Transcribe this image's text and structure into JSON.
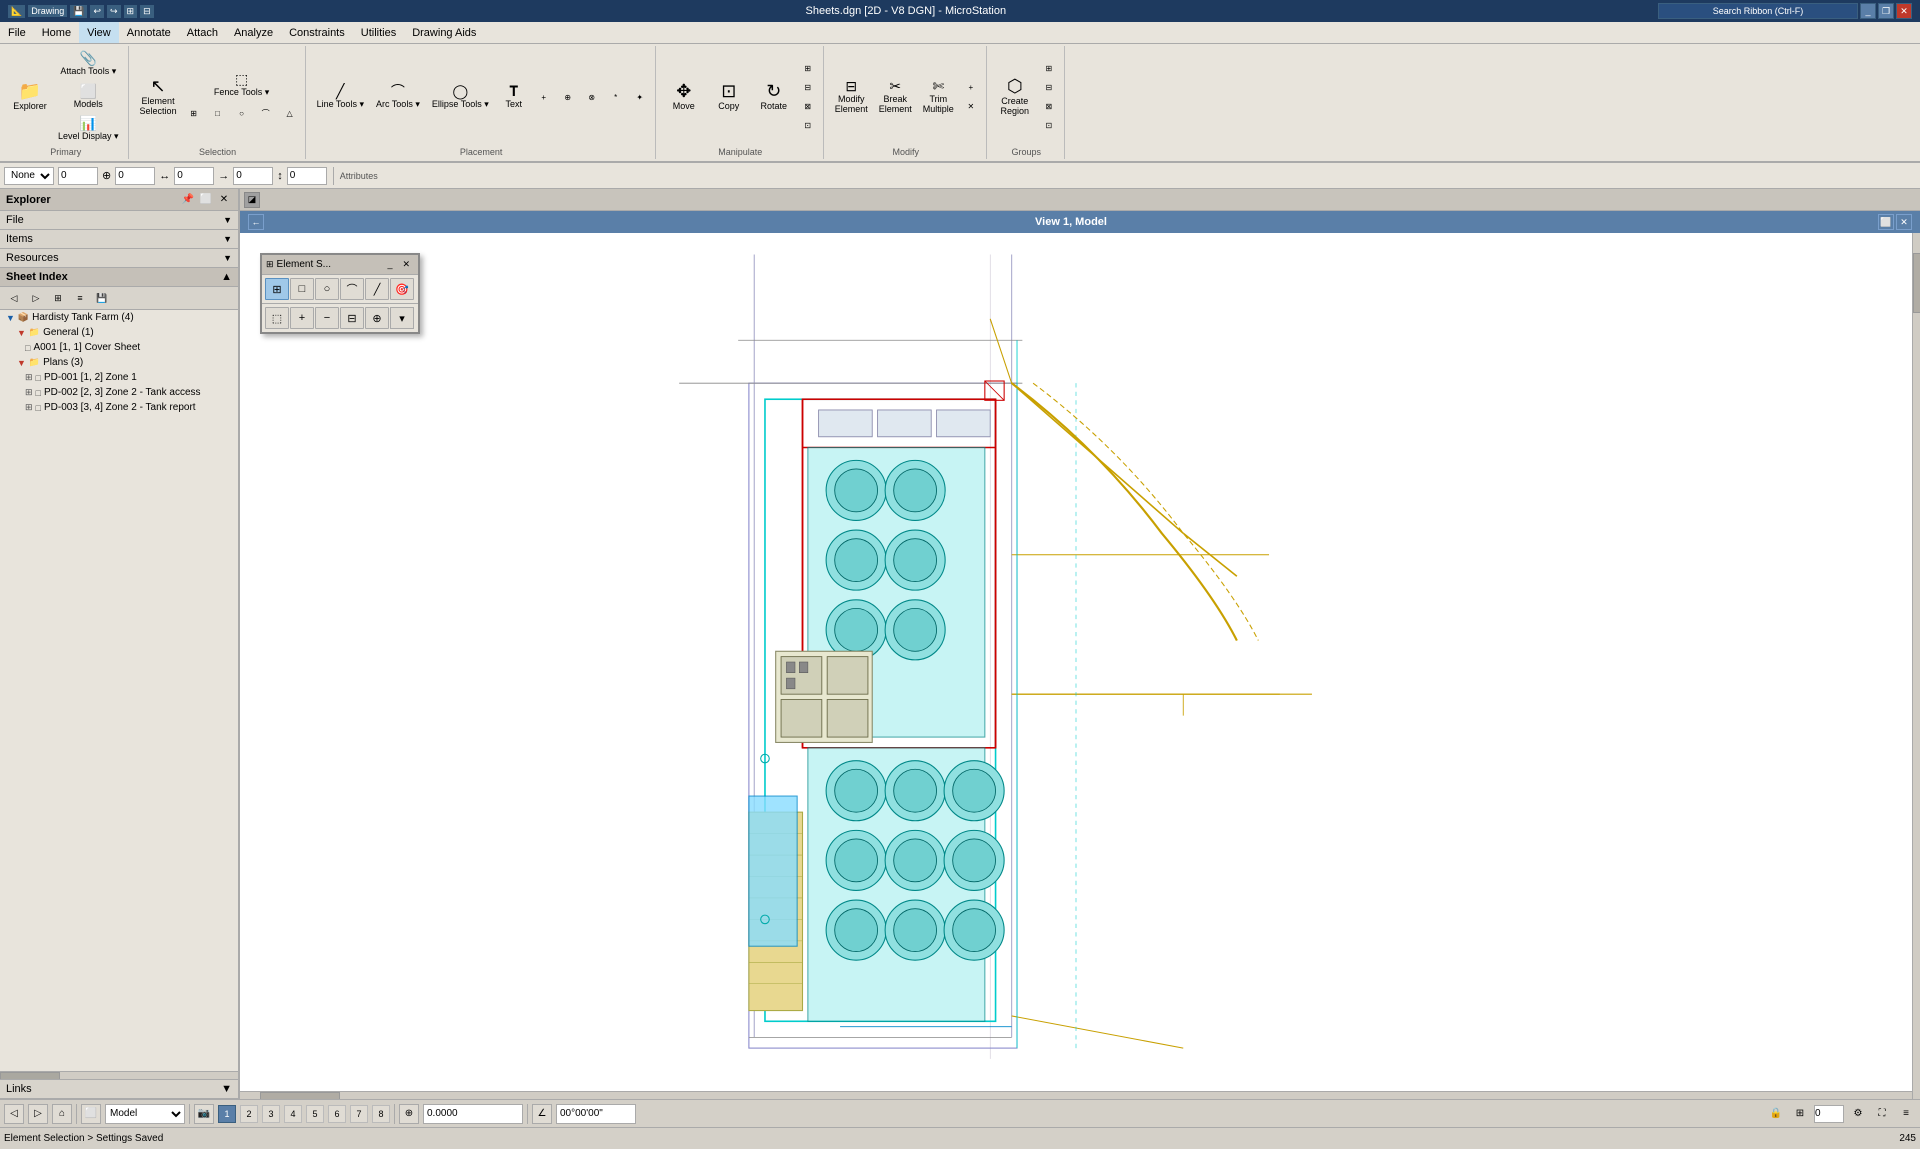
{
  "titleBar": {
    "title": "Sheets.dgn [2D - V8 DGN] - MicroStation",
    "appName": "Drawing",
    "windowControls": [
      "minimize",
      "maximize",
      "restore",
      "close"
    ]
  },
  "menuBar": {
    "items": [
      "File",
      "Home",
      "View",
      "Annotate",
      "Attach",
      "Analyze",
      "Constraints",
      "Utilities",
      "Drawing Aids"
    ]
  },
  "ribbonTabs": {
    "active": "View",
    "tabs": [
      "File",
      "Home",
      "View",
      "Annotate",
      "Attach",
      "Analyze",
      "Constraints",
      "Utilities",
      "Drawing Aids"
    ]
  },
  "ribbonGroups": {
    "primary": {
      "title": "Primary",
      "buttons": [
        "Explorer",
        "Attach Tools",
        "Models",
        "Level Display"
      ]
    },
    "selection": {
      "title": "Selection",
      "buttons": [
        "Element Selection",
        "Fence Tools",
        "Selection"
      ]
    },
    "placement": {
      "title": "Placement",
      "buttons": [
        "Line Tools",
        "Arc Tools",
        "Ellipse Tools",
        "Text"
      ]
    },
    "manipulate": {
      "title": "Manipulate",
      "buttons": [
        "Move",
        "Copy",
        "Rotate"
      ]
    },
    "modify": {
      "title": "Modify",
      "buttons": [
        "Modify Element",
        "Break Element",
        "Trim Multiple"
      ]
    },
    "groups": {
      "title": "Groups",
      "buttons": [
        "Create Region"
      ]
    }
  },
  "attrBar": {
    "activeAngle": "None",
    "value1": "0",
    "value2": "0",
    "value3": "0",
    "value4": "0",
    "value5": "0",
    "label": "Attributes"
  },
  "leftPanel": {
    "title": "Explorer",
    "sections": {
      "file": {
        "label": "File",
        "expanded": true
      },
      "items": {
        "label": "Items",
        "expanded": false
      },
      "resources": {
        "label": "Resources",
        "expanded": false
      }
    },
    "sheetIndex": {
      "title": "Sheet Index",
      "root": {
        "name": "Hardisty Tank Farm (4)",
        "children": [
          {
            "name": "General (1)",
            "children": [
              {
                "name": "A001 [1, 1] Cover Sheet"
              }
            ]
          },
          {
            "name": "Plans (3)",
            "children": [
              {
                "name": "PD-001 [1, 2] Zone 1"
              },
              {
                "name": "PD-002 [2, 3] Zone 2 - Tank access"
              },
              {
                "name": "PD-003 [3, 4] Zone 2 - Tank report"
              }
            ]
          }
        ]
      }
    },
    "links": {
      "label": "Links"
    }
  },
  "viewHeader": {
    "title": "View 1, Model"
  },
  "elementSelPanel": {
    "title": "Element S...",
    "toolbar1": {
      "buttons": [
        "rect-select",
        "line-select",
        "circle-select",
        "arc-select",
        "poly-select",
        "target-icon"
      ]
    },
    "toolbar2": {
      "buttons": [
        "block-select",
        "add",
        "subtract",
        "mask-select",
        "zoom-select",
        "dropdown"
      ]
    }
  },
  "bottomToolbar": {
    "modelName": "Model",
    "pages": [
      "1",
      "2",
      "3",
      "4",
      "5",
      "6",
      "7",
      "8"
    ],
    "activePage": "1",
    "coords": "0.0000",
    "angle": "00°00'00\"",
    "zoom": ""
  },
  "statusBar": {
    "text": "Element Selection > Settings Saved"
  }
}
